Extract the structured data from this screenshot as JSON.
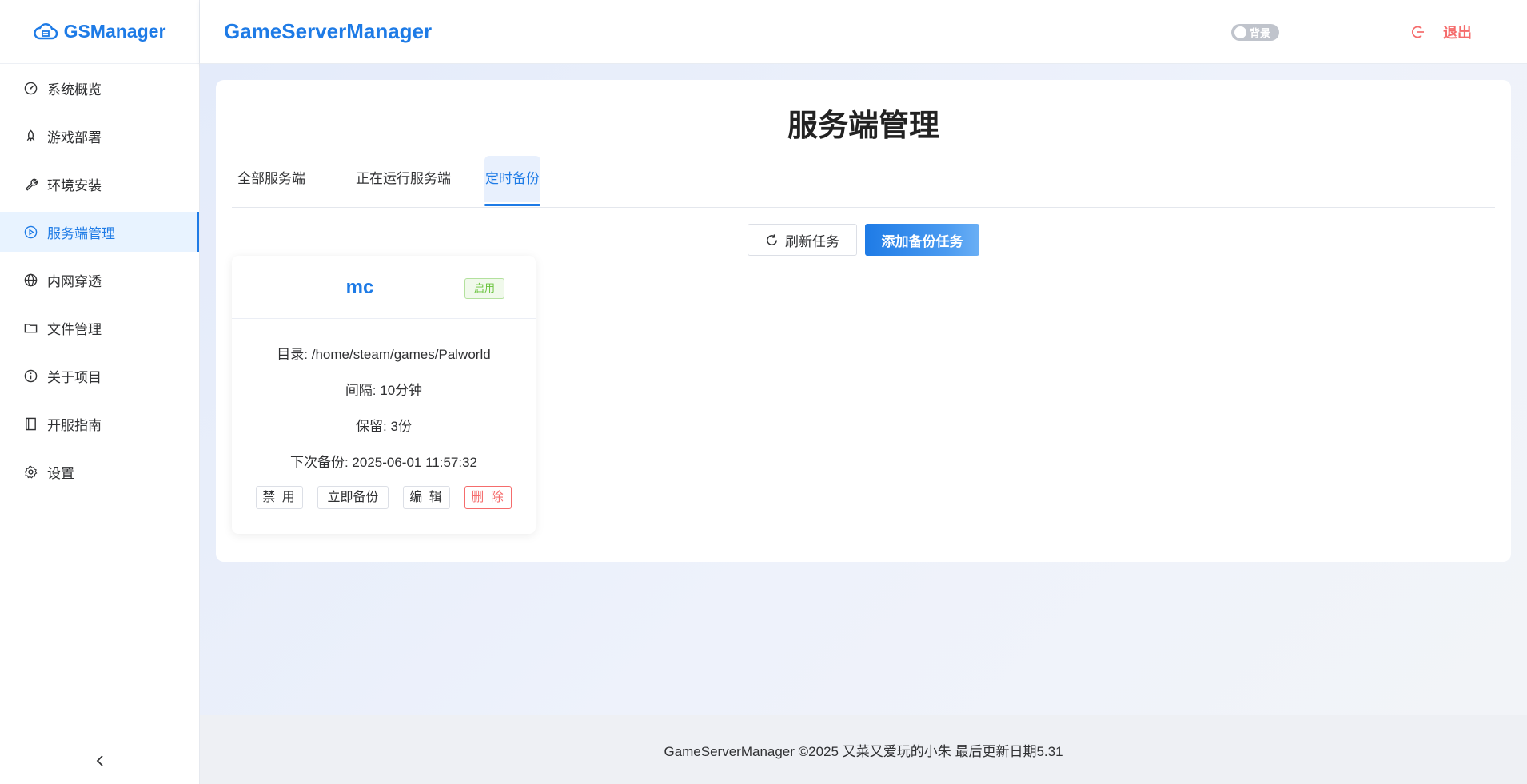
{
  "brand": {
    "name": "GSManager",
    "icon": "cloud-server-icon"
  },
  "header": {
    "title": "GameServerManager",
    "bg_toggle_label": "背景",
    "logout_label": "退出",
    "logout_icon": "logout-icon"
  },
  "sidebar": {
    "items": [
      {
        "label": "系统概览",
        "icon": "dashboard-icon",
        "active": false
      },
      {
        "label": "游戏部署",
        "icon": "rocket-icon",
        "active": false
      },
      {
        "label": "环境安装",
        "icon": "wrench-icon",
        "active": false
      },
      {
        "label": "服务端管理",
        "icon": "play-circle-icon",
        "active": true
      },
      {
        "label": "内网穿透",
        "icon": "globe-icon",
        "active": false
      },
      {
        "label": "文件管理",
        "icon": "folder-icon",
        "active": false
      },
      {
        "label": "关于项目",
        "icon": "info-icon",
        "active": false
      },
      {
        "label": "开服指南",
        "icon": "book-icon",
        "active": false
      },
      {
        "label": "设置",
        "icon": "gear-icon",
        "active": false
      }
    ],
    "collapse_icon": "chevron-left-icon"
  },
  "main": {
    "page_title": "服务端管理",
    "tabs": [
      {
        "label": "全部服务端",
        "active": false
      },
      {
        "label": "正在运行服务端",
        "active": false
      },
      {
        "label": "定时备份",
        "active": true
      }
    ],
    "refresh_label": "刷新任务",
    "add_label": "添加备份任务",
    "card": {
      "name": "mc",
      "status": "启用",
      "directory": "目录: /home/steam/games/Palworld",
      "interval": "间隔: 10分钟",
      "retain": "保留: 3份",
      "next_backup": "下次备份: 2025-06-01 11:57:32",
      "actions": {
        "disable": "禁 用",
        "backup_now": "立即备份",
        "edit": "编 辑",
        "delete": "删 除"
      }
    }
  },
  "footer": {
    "text": "GameServerManager ©2025 又菜又爱玩的小朱 最后更新日期5.31"
  },
  "colors": {
    "accent": "#1e7be6",
    "danger": "#f56c6c",
    "success": "#67c23a"
  }
}
